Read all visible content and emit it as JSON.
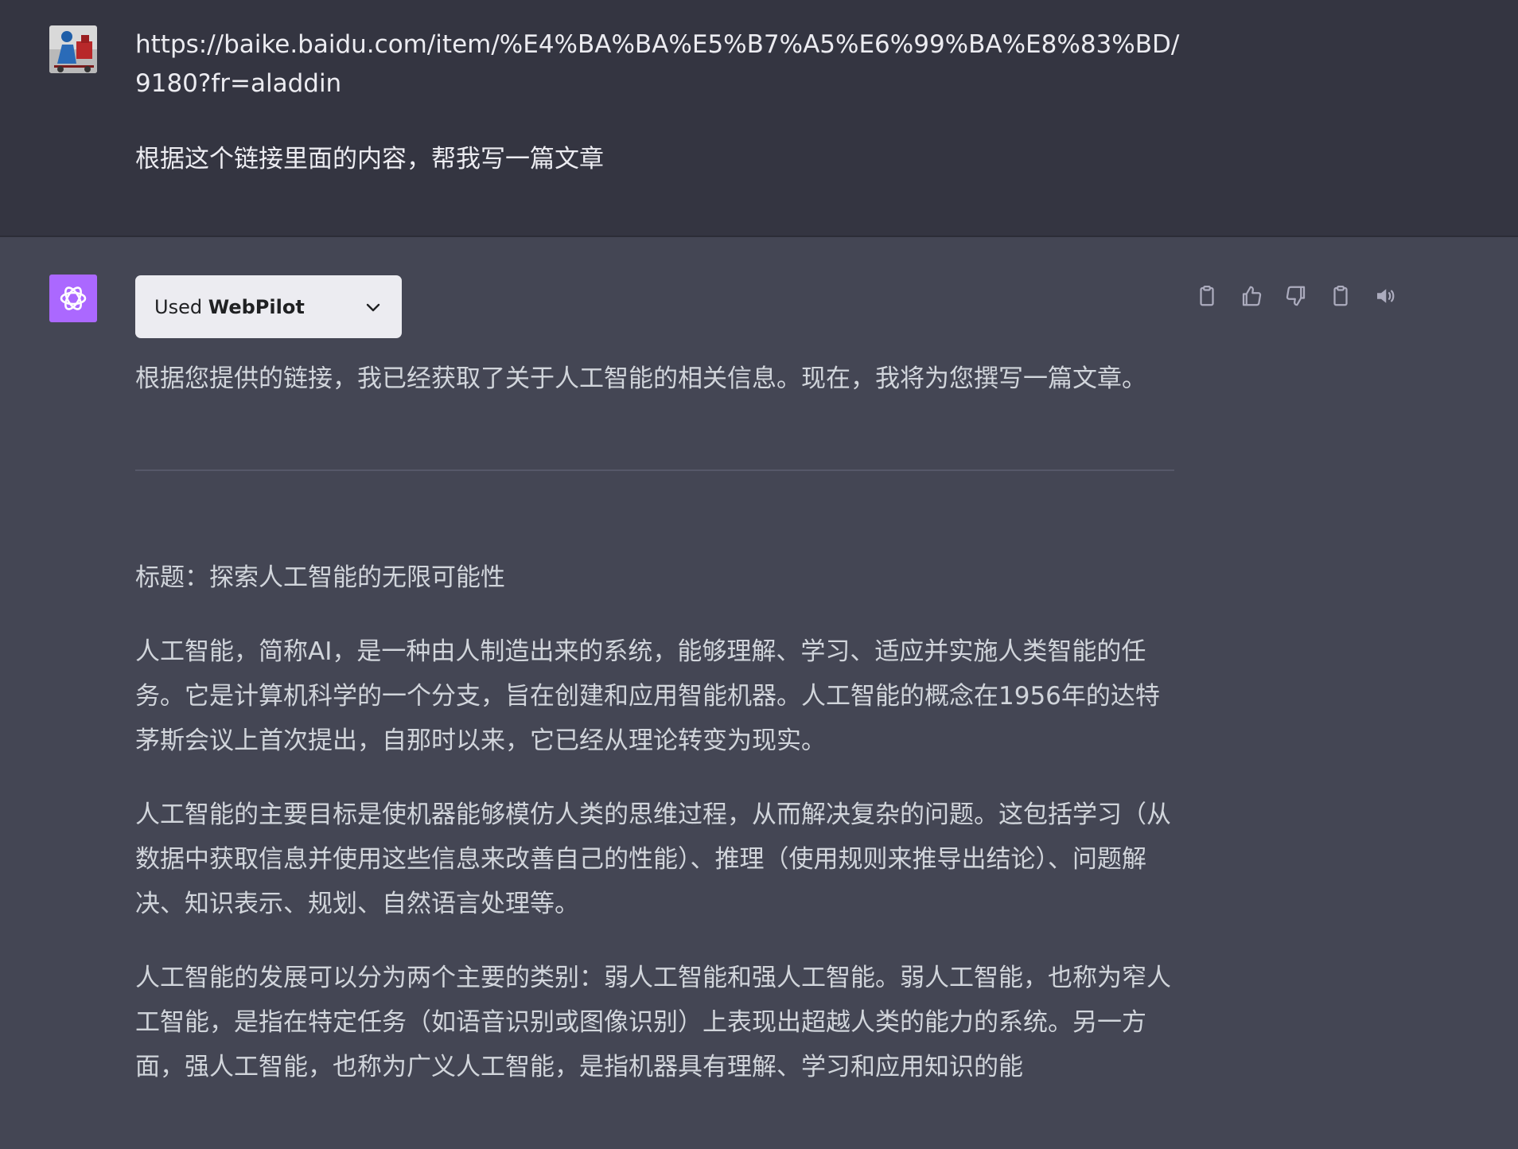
{
  "user": {
    "avatar_icon": "user-photo-avatar",
    "url": "https://baike.baidu.com/item/%E4%BA%BA%E5%B7%A5%E6%99%BA%E8%83%BD/9180?fr=aladdin",
    "prompt": "根据这个链接里面的内容，帮我写一篇文章"
  },
  "assistant": {
    "avatar_icon": "openai-logo",
    "avatar_color": "#ab68ff",
    "plugin": {
      "prefix": "Used",
      "name": "WebPilot",
      "icon": "chevron-down-icon"
    },
    "actions": [
      {
        "name": "copy-icon"
      },
      {
        "name": "thumbs-up-icon"
      },
      {
        "name": "thumbs-down-icon"
      },
      {
        "name": "clipboard-icon"
      },
      {
        "name": "speaker-icon"
      }
    ],
    "intro": "根据您提供的链接，我已经获取了关于人工智能的相关信息。现在，我将为您撰写一篇文章。",
    "title": "标题：探索人工智能的无限可能性",
    "paragraphs": [
      "人工智能，简称AI，是一种由人制造出来的系统，能够理解、学习、适应并实施人类智能的任务。它是计算机科学的一个分支，旨在创建和应用智能机器。人工智能的概念在1956年的达特茅斯会议上首次提出，自那时以来，它已经从理论转变为现实。",
      "人工智能的主要目标是使机器能够模仿人类的思维过程，从而解决复杂的问题。这包括学习（从数据中获取信息并使用这些信息来改善自己的性能）、推理（使用规则来推导出结论）、问题解决、知识表示、规划、自然语言处理等。",
      "人工智能的发展可以分为两个主要的类别：弱人工智能和强人工智能。弱人工智能，也称为窄人工智能，是指在特定任务（如语音识别或图像识别）上表现出超越人类的能力的系统。另一方面，强人工智能，也称为广义人工智能，是指机器具有理解、学习和应用知识的能"
    ]
  },
  "colors": {
    "user_bg": "#343541",
    "assistant_bg": "#444654",
    "text": "#d1d5db",
    "chip_bg": "#ececf1"
  }
}
